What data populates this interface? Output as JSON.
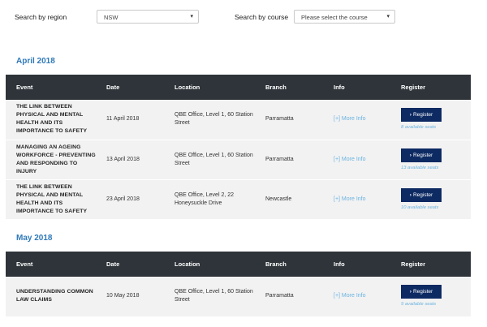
{
  "filters": {
    "region_label": "Search by region",
    "region_value": "NSW",
    "course_label": "Search by course",
    "course_value": "Please select the course"
  },
  "columns": [
    "Event",
    "Date",
    "Location",
    "Branch",
    "Info",
    "Register"
  ],
  "register_label": "Register",
  "info_label": "[+] More Info",
  "sections": [
    {
      "title": "April 2018",
      "rows": [
        {
          "event": "THE LINK BETWEEN PHYSICAL AND MENTAL HEALTH AND ITS IMPORTANCE TO SAFETY",
          "date": "11 April 2018",
          "location": "QBE Office, Level 1, 60 Station Street",
          "branch": "Parramatta",
          "seats": "8 available seats"
        },
        {
          "event": "MANAGING AN AGEING WORKFORCE - PREVENTING AND RESPONDING TO INJURY",
          "date": "13 April 2018",
          "location": "QBE Office, Level 1, 60 Station Street",
          "branch": "Parramatta",
          "seats": "13 available seats"
        },
        {
          "event": "THE LINK BETWEEN PHYSICAL AND MENTAL HEALTH AND ITS IMPORTANCE TO SAFETY",
          "date": "23 April 2018",
          "location": "QBE Office, Level 2, 22 Honeysuckle Drive",
          "branch": "Newcastle",
          "seats": "10 available seats"
        }
      ]
    },
    {
      "title": "May 2018",
      "rows": [
        {
          "event": "UNDERSTANDING COMMON LAW CLAIMS",
          "date": "10 May 2018",
          "location": "QBE Office, Level 1, 60 Station Street",
          "branch": "Parramatta",
          "seats": "9 available seats"
        }
      ]
    }
  ],
  "colors": {
    "header_bg": "#2e3439",
    "accent": "#2f79b9",
    "button": "#0d2a63",
    "link": "#6bb3e0",
    "row_bg": "#f2f2f2"
  }
}
